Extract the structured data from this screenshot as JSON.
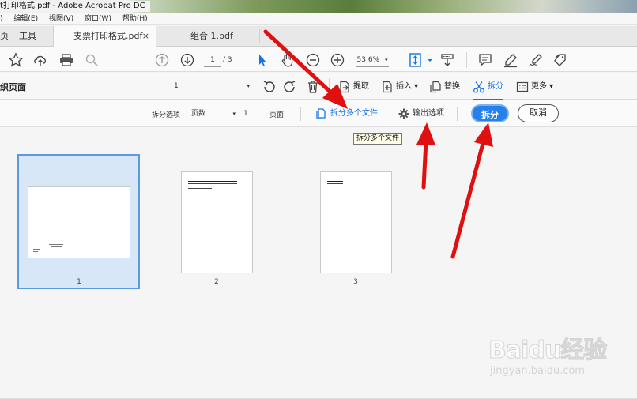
{
  "window": {
    "title": "t打印格式.pdf - Adobe Acrobat Pro DC"
  },
  "menubar": {
    "items": [
      ")",
      "编辑(E)",
      "视图(V)",
      "窗口(W)",
      "帮助(H)"
    ]
  },
  "tabs": {
    "home": "页",
    "tools": "工具",
    "doc1": "支票打印格式.pdf",
    "doc1_close": "×",
    "doc2": "组合 1.pdf"
  },
  "toolbar": {
    "page_current": "1",
    "page_total": "/ 3",
    "zoom": "53.6%",
    "zoom_caret": "▾"
  },
  "organize": {
    "title": "织页面",
    "range": "1",
    "range_caret": "▾",
    "extract": "提取",
    "insert": "插入 ▾",
    "replace": "替换",
    "split": "拆分",
    "more": "更多 ▾"
  },
  "split_options": {
    "label": "拆分选项",
    "by": "页数",
    "by_caret": "▾",
    "count": "1",
    "unit": "页面",
    "multi_files": "拆分多个文件",
    "output_options": "输出选项",
    "split_button": "拆分",
    "cancel_button": "取消",
    "tooltip": "拆分多个文件"
  },
  "thumbnails": [
    {
      "number": "1",
      "selected": true
    },
    {
      "number": "2",
      "selected": false
    },
    {
      "number": "3",
      "selected": false
    }
  ],
  "watermark": {
    "brand": "Baidu经验",
    "url": "jingyan.baidu.com"
  },
  "colors": {
    "accent": "#1473e6",
    "primary_button": "#2680eb",
    "arrow": "#e01010",
    "selection": "#d7e7f8"
  }
}
